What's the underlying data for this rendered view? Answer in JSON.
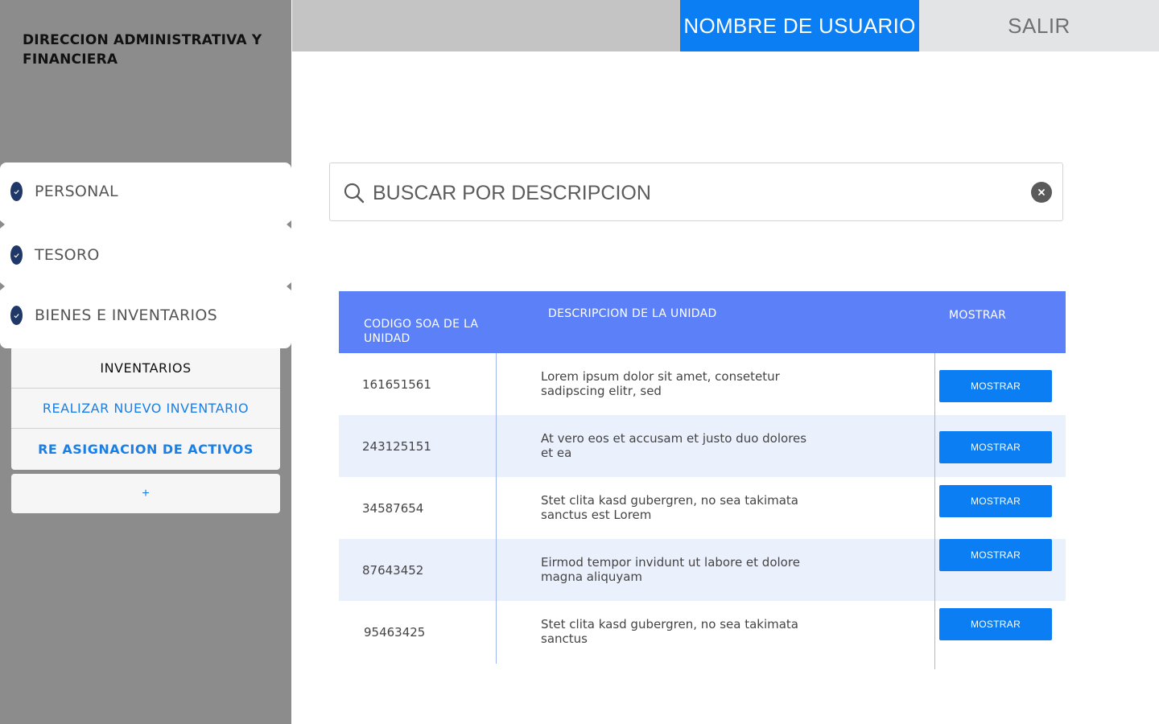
{
  "sidebar": {
    "org_title": "DIRECCION ADMINISTRATIVA Y FINANCIERA",
    "menu": [
      {
        "label": "PERSONAL",
        "icon": "check-circle-icon"
      },
      {
        "label": "TESORO",
        "icon": "check-circle-icon"
      },
      {
        "label": "BIENES E INVENTARIOS",
        "icon": "check-circle-icon"
      }
    ],
    "submenu": {
      "title": "INVENTARIOS",
      "items": [
        "REALIZAR NUEVO INVENTARIO",
        "RE ASIGNACION DE ACTIVOS"
      ],
      "add_label": "+"
    }
  },
  "header": {
    "user_label": "NOMBRE DE USUARIO",
    "exit_label": "SALIR"
  },
  "search": {
    "placeholder": "BUSCAR POR DESCRIPCION",
    "icon": "search-icon",
    "clear_icon": "clear-icon"
  },
  "table": {
    "columns": [
      "CODIGO SOA DE LA UNIDAD",
      "DESCRIPCION DE LA UNIDAD",
      "MOSTRAR"
    ],
    "rows": [
      {
        "code": "161651561",
        "desc": "Lorem ipsum dolor sit amet, consetetur sadipscing elitr, sed",
        "action": "MOSTRAR"
      },
      {
        "code": "243125151",
        "desc": "At vero eos et accusam et justo duo dolores et ea",
        "action": "MOSTRAR"
      },
      {
        "code": "34587654",
        "desc": "Stet clita kasd gubergren, no sea takimata sanctus est Lorem",
        "action": "MOSTRAR"
      },
      {
        "code": "87643452",
        "desc": "Eirmod tempor invidunt ut labore et dolore magna aliquyam",
        "action": "MOSTRAR"
      },
      {
        "code": "95463425",
        "desc": "Stet clita kasd gubergren, no sea takimata sanctus",
        "action": "MOSTRAR"
      }
    ]
  },
  "colors": {
    "accent": "#0a7ef2",
    "table_header": "#5b80f7",
    "row_alt": "#ebf0fd",
    "sidebar": "#8c8c8c",
    "check": "#1f3868"
  }
}
